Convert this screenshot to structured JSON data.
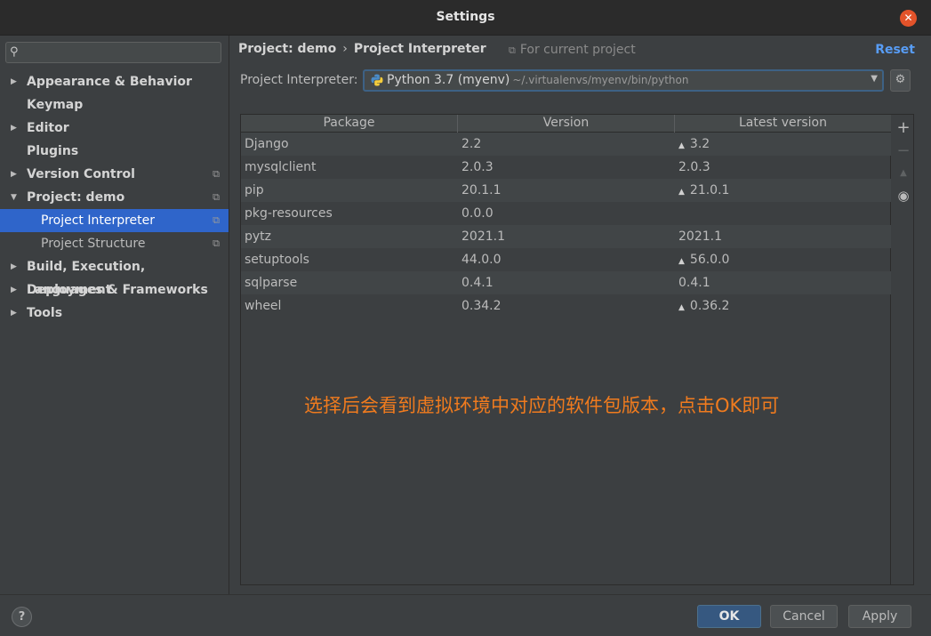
{
  "window": {
    "title": "Settings"
  },
  "sidebar": {
    "search": {
      "value": "",
      "placeholder": ""
    },
    "items": [
      {
        "label": "Appearance & Behavior",
        "arrow": "▶",
        "scope": ""
      },
      {
        "label": "Keymap",
        "arrow": "",
        "scope": ""
      },
      {
        "label": "Editor",
        "arrow": "▶",
        "scope": ""
      },
      {
        "label": "Plugins",
        "arrow": "",
        "scope": ""
      },
      {
        "label": "Version Control",
        "arrow": "▶",
        "scope": "⧉"
      },
      {
        "label": "Project: demo",
        "arrow": "▼",
        "scope": "⧉"
      },
      {
        "label": "Project Interpreter",
        "arrow": "",
        "scope": "⧉"
      },
      {
        "label": "Project Structure",
        "arrow": "",
        "scope": "⧉"
      },
      {
        "label": "Build, Execution, Deployment",
        "arrow": "▶",
        "scope": ""
      },
      {
        "label": "Languages & Frameworks",
        "arrow": "▶",
        "scope": ""
      },
      {
        "label": "Tools",
        "arrow": "▶",
        "scope": ""
      }
    ],
    "selected": "Project Interpreter"
  },
  "main": {
    "breadcrumb": {
      "parent": "Project: demo",
      "separator": "›",
      "current": "Project Interpreter"
    },
    "scope_note": "For current project",
    "reset_label": "Reset",
    "interpreter": {
      "label": "Project Interpreter:",
      "name": "Python 3.7 (myenv)",
      "path": "~/.virtualenvs/myenv/bin/python"
    },
    "table": {
      "columns": [
        "Package",
        "Version",
        "Latest version"
      ],
      "rows": [
        {
          "package": "Django",
          "version": "2.2",
          "latest": "3.2",
          "upgrade": true
        },
        {
          "package": "mysqlclient",
          "version": "2.0.3",
          "latest": "2.0.3",
          "upgrade": false
        },
        {
          "package": "pip",
          "version": "20.1.1",
          "latest": "21.0.1",
          "upgrade": true
        },
        {
          "package": "pkg-resources",
          "version": "0.0.0",
          "latest": "",
          "upgrade": false
        },
        {
          "package": "pytz",
          "version": "2021.1",
          "latest": "2021.1",
          "upgrade": false
        },
        {
          "package": "setuptools",
          "version": "44.0.0",
          "latest": "56.0.0",
          "upgrade": true
        },
        {
          "package": "sqlparse",
          "version": "0.4.1",
          "latest": "0.4.1",
          "upgrade": false
        },
        {
          "package": "wheel",
          "version": "0.34.2",
          "latest": "0.36.2",
          "upgrade": true
        }
      ]
    },
    "annotation": "选择后会看到虚拟环境中对应的软件包版本，点击OK即可"
  },
  "footer": {
    "help": "?",
    "ok": "OK",
    "cancel": "Cancel",
    "apply": "Apply"
  },
  "colors": {
    "accent": "#2f65ca",
    "link": "#589df6",
    "annotation": "#f07b1e",
    "close": "#e3532a"
  }
}
